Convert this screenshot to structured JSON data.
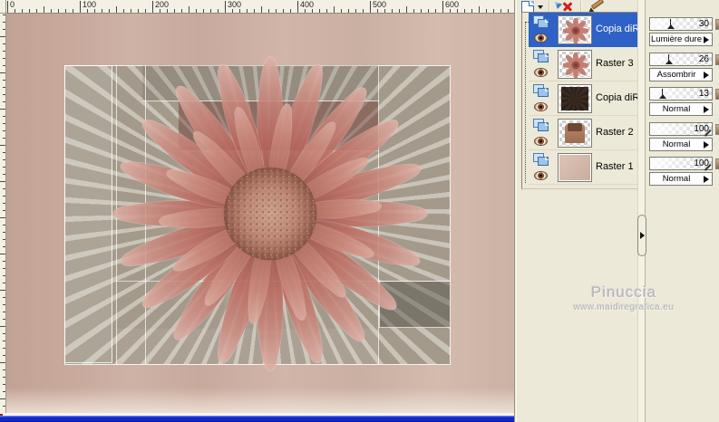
{
  "app": {
    "name": "layers-palette-screenshot"
  },
  "ruler": {
    "labels": [
      "0",
      "100",
      "200",
      "300",
      "400",
      "500",
      "600"
    ]
  },
  "toolbar": {
    "buttons": [
      {
        "label": "New layer",
        "icon": "new-layer-icon"
      },
      {
        "label": "Delete layer",
        "icon": "delete-red-x-icon"
      },
      {
        "label": "Edit",
        "icon": "pencil-icon"
      }
    ]
  },
  "layers": {
    "items": [
      {
        "name": "Copia diRaster",
        "selected": true,
        "opacity": 30,
        "blend_mode": "Lumière dure",
        "thumb": "flower-thumbnail"
      },
      {
        "name": "Raster 3",
        "selected": false,
        "opacity": 26,
        "blend_mode": "Assombrir",
        "thumb": "flower-thumbnail"
      },
      {
        "name": "Copia diRaster",
        "selected": false,
        "opacity": 13,
        "blend_mode": "Normal",
        "thumb": "dark-rays-thumbnail"
      },
      {
        "name": "Raster 2",
        "selected": false,
        "opacity": 100,
        "blend_mode": "Normal",
        "thumb": "brown-shape-thumbnail"
      },
      {
        "name": "Raster 1",
        "selected": false,
        "opacity": 100,
        "blend_mode": "Normal",
        "thumb": "plain-beige-thumbnail"
      }
    ]
  },
  "watermark": {
    "line1": "Pinuccia",
    "line2": "www.maidiregrafica.eu"
  },
  "colors": {
    "selection_blue": "#2e62c6",
    "palette_beige": "#ece9d8",
    "canvas_pink": "#ccb0a3",
    "maroon_overlay": "#6c2e28",
    "bottom_bar_blue": "#1028cf",
    "watermark_gray": "#b3b1c2"
  },
  "icons": {
    "dropdown_caret": "▼",
    "blend_arrow": "▶",
    "divider_arrow": "▶",
    "delete": "✕"
  }
}
